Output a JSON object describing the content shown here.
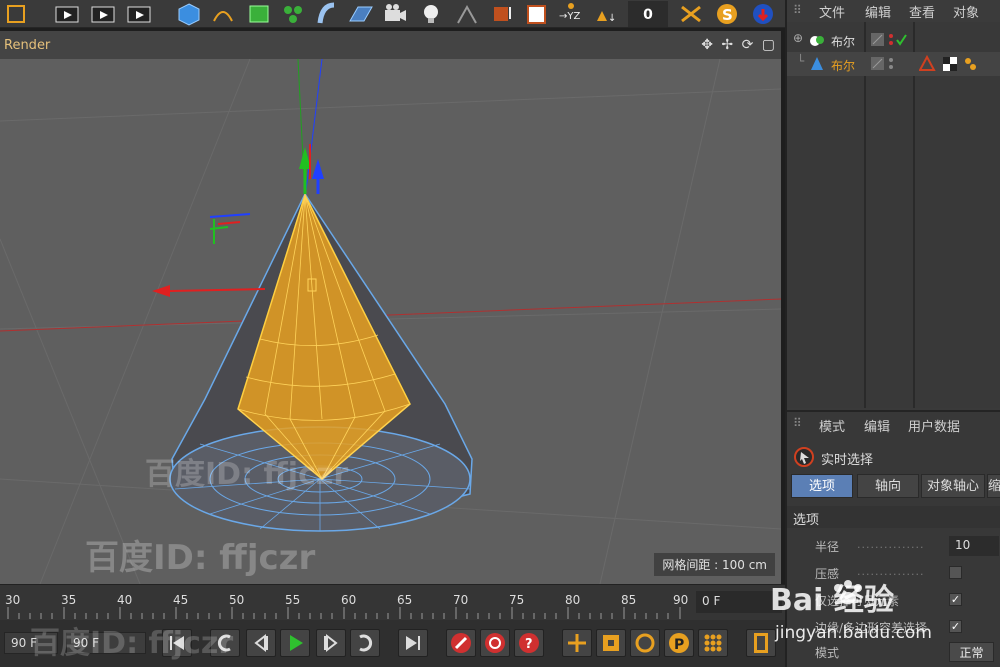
{
  "toolbar": {
    "coord_value": "0",
    "icons": [
      "undo-icon",
      "render-view-icon",
      "render-picture-queue-icon",
      "render-settings-icon",
      "cube-icon",
      "pen-spline-icon",
      "subdivision-icon",
      "array-icon",
      "deformer-icon",
      "floor-icon",
      "camera-icon",
      "light-icon",
      "snap-icon",
      "modeling-axis-icon",
      "workplane-icon",
      "coordinate-axis-icon",
      "locking-icon",
      "sculpt-icon",
      "s-script-icon",
      "shader-icon"
    ]
  },
  "viewport": {
    "title": "Render",
    "nav_icons": "✥ ✢ ⟳ ▢",
    "grid_label": "网格间距 : 100 cm"
  },
  "timeline": {
    "ticks": [
      "30",
      "35",
      "40",
      "45",
      "50",
      "55",
      "60",
      "65",
      "70",
      "75",
      "80",
      "85",
      "90"
    ],
    "current_frame": "0 F"
  },
  "playbar": {
    "start_field": "90 F",
    "end_field": "90 F"
  },
  "object_manager": {
    "menu": [
      "文件",
      "编辑",
      "查看",
      "对象"
    ],
    "objects": [
      {
        "name": "布尔",
        "type": "boole"
      },
      {
        "name": "布尔",
        "type": "cone-child"
      }
    ]
  },
  "attributes": {
    "menu": [
      "模式",
      "编辑",
      "用户数据"
    ],
    "mode_title": "实时选择",
    "tabs": [
      "选项",
      "轴向",
      "对象轴心",
      "缩"
    ],
    "section": "选项",
    "properties": [
      {
        "label": "半径",
        "value": "10"
      },
      {
        "label": "压感",
        "value": ""
      },
      {
        "label": "仅选择可见元素",
        "value": "✓"
      },
      {
        "label": "边缘/多边形容差选择",
        "value": "✓"
      }
    ],
    "mode_label": "模式",
    "mode_value": "正常"
  },
  "watermarks": {
    "user_id": "百度ID: ffjczr",
    "site_logo": "Bai 经验",
    "site_url": "jingyan.baidu.com"
  },
  "colors": {
    "selection_orange": "#e8a020",
    "mesh_blue": "#6aa8e8",
    "axis_x": "#e02020",
    "axis_y": "#20c020",
    "axis_z": "#2040ff",
    "viewport_bg": "#5f5f5f"
  }
}
